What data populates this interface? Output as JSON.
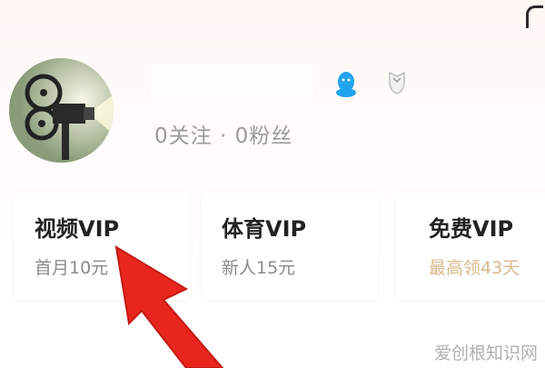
{
  "profile": {
    "follow_stats": "0关注 · 0粉丝"
  },
  "vip_cards": [
    {
      "title": "视频VIP",
      "subtitle": "首月10元"
    },
    {
      "title": "体育VIP",
      "subtitle": "新人15元"
    },
    {
      "title": "免费VIP",
      "subtitle": "最高领43天"
    }
  ],
  "watermark": "爱创根知识网",
  "colors": {
    "arrow": "#e8261e",
    "free_vip_subtitle": "#d9b98a",
    "qq_icon": "#22a3f0"
  }
}
